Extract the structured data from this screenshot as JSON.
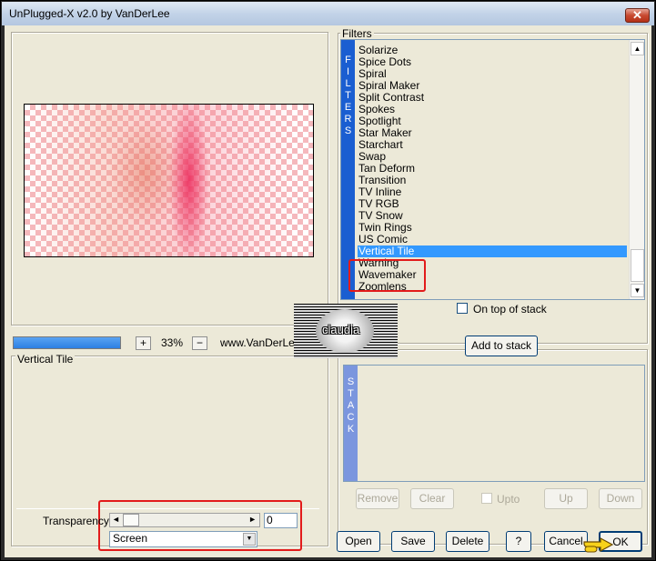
{
  "window": {
    "title": "UnPlugged-X v2.0 by VanDerLee",
    "close_glyph": "✕"
  },
  "preview": {
    "progress": 1.0,
    "zoom_minus": "−",
    "zoom_plus": "+",
    "zoom_value": "33%",
    "website": "www.VanDerLee.com"
  },
  "effect": {
    "title": "Vertical Tile"
  },
  "transparency": {
    "label": "Transparency",
    "value": "0",
    "blend_mode": "Screen",
    "left_arrow": "◄",
    "right_arrow": "►"
  },
  "filters": {
    "group_label": "Filters",
    "strip_letters": [
      "F",
      "I",
      "L",
      "T",
      "E",
      "R",
      "S"
    ],
    "items": [
      "Solarize",
      "Spice Dots",
      "Spiral",
      "Spiral Maker",
      "Split Contrast",
      "Spokes",
      "Spotlight",
      "Star Maker",
      "Starchart",
      "Swap",
      "Tan Deform",
      "Transition",
      "TV Inline",
      "TV RGB",
      "TV Snow",
      "Twin Rings",
      "US Comic",
      "Vertical Tile",
      "Warning",
      "Wavemaker",
      "Zoomlens"
    ],
    "selected": "Vertical Tile",
    "on_top_label": "On top of stack",
    "scroll_up": "▲",
    "scroll_down": "▼"
  },
  "stack": {
    "add_label": "Add to stack",
    "strip_letters": [
      "S",
      "T",
      "A",
      "C",
      "K"
    ],
    "remove_label": "Remove",
    "clear_label": "Clear",
    "upto_label": "Upto",
    "up_label": "Up",
    "down_label": "Down"
  },
  "footer": {
    "open_label": "Open",
    "save_label": "Save",
    "delete_label": "Delete",
    "help_label": "?",
    "cancel_label": "Cancel",
    "ok_label": "OK"
  },
  "watermark": {
    "text": "claudia"
  },
  "colors": {
    "accent": "#1a5ed1",
    "selection": "#3399ff",
    "highlight": "#e21b1b"
  }
}
